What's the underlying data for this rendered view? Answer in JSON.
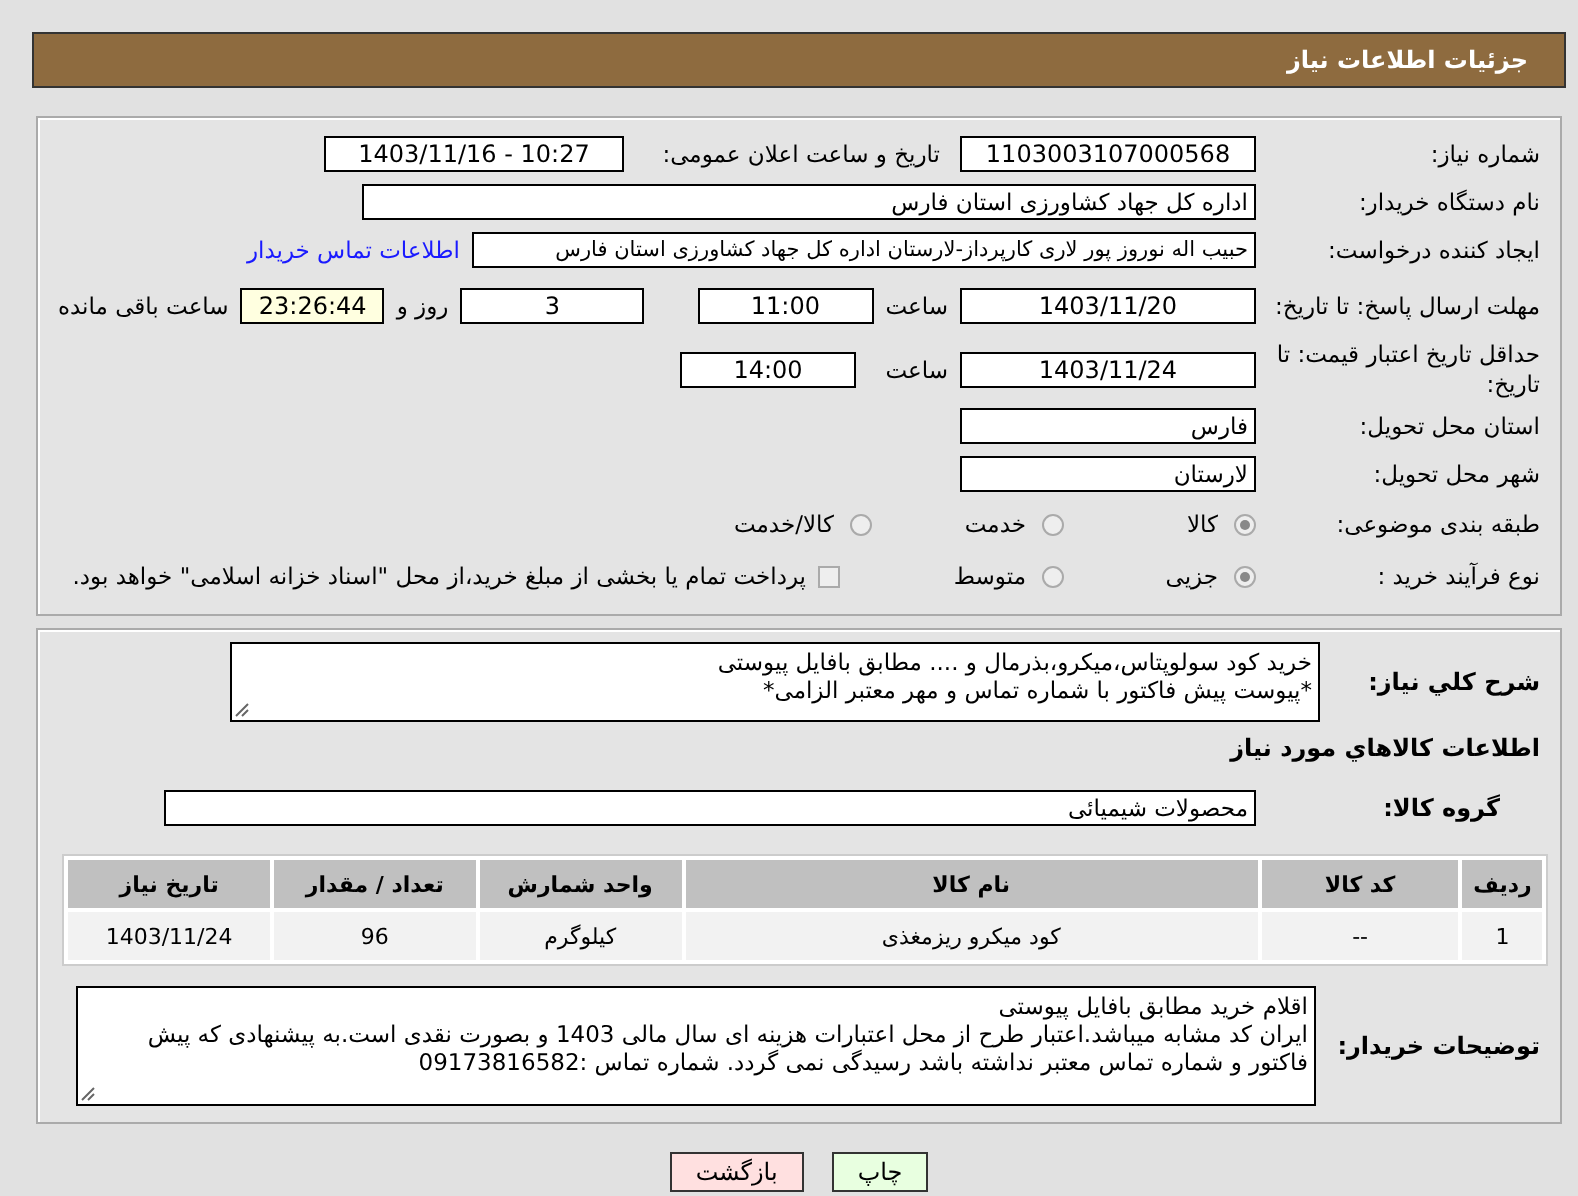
{
  "header": {
    "title": "جزئیات اطلاعات نیاز"
  },
  "need_number": {
    "label": "شماره نیاز:",
    "value": "1103003107000568"
  },
  "announce": {
    "label": "تاریخ و ساعت اعلان عمومی:",
    "value": "1403/11/16 - 10:27"
  },
  "buyer_org": {
    "label": "نام دستگاه خریدار:",
    "value": "اداره کل جهاد کشاورزی استان فارس"
  },
  "requester": {
    "label": "ایجاد کننده درخواست:",
    "value": "حبیب اله  نوروز پور لاری کارپرداز-لارستان اداره کل جهاد کشاورزی استان فارس",
    "link": "اطلاعات تماس خریدار"
  },
  "reply_deadline": {
    "label": "مهلت ارسال پاسخ: تا تاریخ:",
    "date": "1403/11/20",
    "time_label": "ساعت",
    "time": "11:00",
    "days": "3",
    "days_label": "روز و",
    "remaining": "23:26:44",
    "remaining_label": "ساعت باقی مانده"
  },
  "price_validity": {
    "label": "حداقل تاریخ اعتبار قیمت: تا تاریخ:",
    "date": "1403/11/24",
    "time_label": "ساعت",
    "time": "14:00"
  },
  "province": {
    "label": "استان محل تحویل:",
    "value": "فارس"
  },
  "city": {
    "label": "شهر محل تحویل:",
    "value": "لارستان"
  },
  "category": {
    "label": "طبقه بندی موضوعی:",
    "options": [
      {
        "label": "کالا",
        "selected": true
      },
      {
        "label": "خدمت",
        "selected": false
      },
      {
        "label": "کالا/خدمت",
        "selected": false
      }
    ]
  },
  "process": {
    "label": "نوع فرآیند خرید :",
    "options": [
      {
        "label": "جزیی",
        "selected": true
      },
      {
        "label": "متوسط",
        "selected": false
      }
    ],
    "payment": {
      "label": "پرداخت تمام یا بخشی از مبلغ خرید،از محل \"اسناد خزانه اسلامی\" خواهد بود.",
      "checked": false
    }
  },
  "description": {
    "label": "شرح کلي نياز:",
    "value": "خرید کود سولوپتاس،میکرو،بذرمال و .... مطابق بافایل پیوستی\n*پیوست پیش فاکتور با شماره تماس و مهر معتبر الزامی*"
  },
  "goods_heading": "اطلاعات کالاهاي مورد نياز",
  "goods_group": {
    "label": "گروه کالا:",
    "value": "محصولات شیمیائی"
  },
  "table": {
    "columns": [
      "ردیف",
      "کد کالا",
      "نام کالا",
      "واحد شمارش",
      "تعداد / مقدار",
      "تاریخ نیاز"
    ],
    "rows": [
      [
        "1",
        "--",
        "کود میکرو ریزمغذی",
        "کیلوگرم",
        "96",
        "1403/11/24"
      ]
    ]
  },
  "buyer_notes": {
    "label": "توضیحات خریدار:",
    "value": "اقلام خرید مطابق بافایل پیوستی\nایران کد مشابه میباشد.اعتبار طرح از محل اعتبارات هزینه ای سال مالی 1403 و بصورت نقدی است.به پیشنهادی که پیش فاکتور و شماره تماس معتبر نداشته باشد رسیدگی نمی گردد. شماره تماس :09173816582"
  },
  "buttons": [
    {
      "label": "چاپ",
      "kind": "print"
    },
    {
      "label": "بازگشت",
      "kind": "back"
    }
  ]
}
